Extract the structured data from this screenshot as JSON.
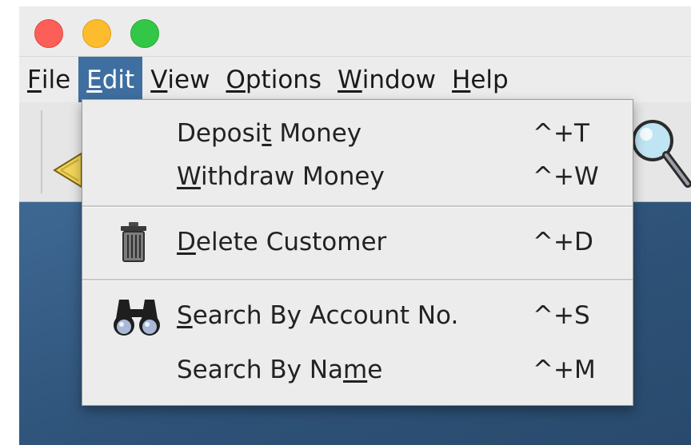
{
  "window": {
    "traffic_lights": [
      {
        "name": "close",
        "color": "#fc5f57"
      },
      {
        "name": "minimize",
        "color": "#fdbc2e"
      },
      {
        "name": "maximize",
        "color": "#33c748"
      }
    ]
  },
  "menubar": {
    "items": [
      {
        "label": "File",
        "mnemonic": "F",
        "rest": "ile",
        "active": false
      },
      {
        "label": "Edit",
        "mnemonic": "E",
        "rest": "dit",
        "active": true
      },
      {
        "label": "View",
        "mnemonic": "V",
        "rest": "iew",
        "active": false
      },
      {
        "label": "Options",
        "mnemonic": "O",
        "rest": "ptions",
        "active": false
      },
      {
        "label": "Window",
        "mnemonic": "W",
        "rest": "indow",
        "active": false
      },
      {
        "label": "Help",
        "mnemonic": "H",
        "rest": "elp",
        "active": false
      }
    ]
  },
  "edit_menu": {
    "items": [
      {
        "label": "Deposit Money",
        "before": "Deposi",
        "mnemonic": "t",
        "after": " Money",
        "accelerator": "^+T",
        "icon": null
      },
      {
        "label": "Withdraw Money",
        "before": "",
        "mnemonic": "W",
        "after": "ithdraw Money",
        "accelerator": "^+W",
        "icon": null
      },
      {
        "label": "Delete Customer",
        "before": "",
        "mnemonic": "D",
        "after": "elete Customer",
        "accelerator": "^+D",
        "icon": "trash-can-icon"
      },
      {
        "label": "Search By Account No.",
        "before": "",
        "mnemonic": "S",
        "after": "earch By Account No.",
        "accelerator": "^+S",
        "icon": "binoculars-icon"
      },
      {
        "label": "Search By Name",
        "before": "Search By Na",
        "mnemonic": "m",
        "after": "e",
        "accelerator": "^+M",
        "icon": null
      }
    ]
  },
  "colors": {
    "menu_highlight": "#3f6fa0",
    "menu_background": "#ececec",
    "desktop": "#2e5278"
  }
}
